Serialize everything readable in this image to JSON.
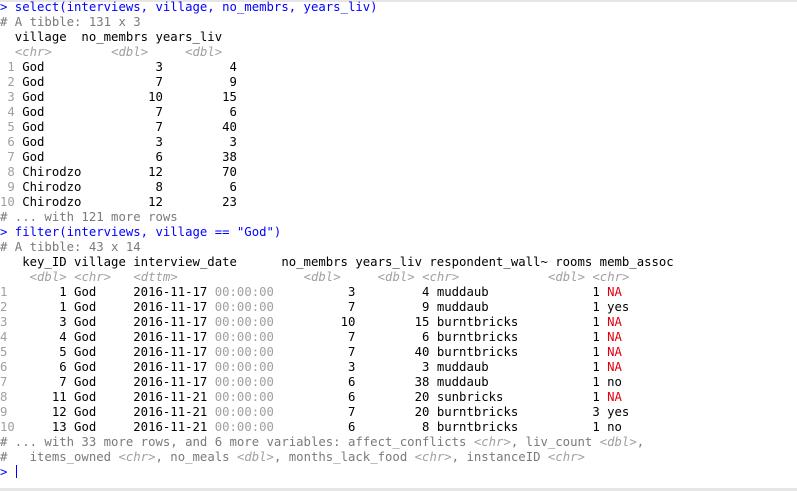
{
  "tibble1": {
    "command": "> select(interviews, village, no_membrs, years_liv)",
    "info": "# A tibble: 131 x 3",
    "header": "  village  no_membrs years_liv",
    "types": [
      {
        "t": "  ",
        "c": ""
      },
      {
        "t": "<chr>",
        "c": "typ"
      },
      {
        "t": "        ",
        "c": ""
      },
      {
        "t": "<dbl>",
        "c": "typ"
      },
      {
        "t": "     ",
        "c": ""
      },
      {
        "t": "<dbl>",
        "c": "typ"
      }
    ],
    "rows": [
      [
        "1",
        "God",
        "3",
        "4"
      ],
      [
        "2",
        "God",
        "7",
        "9"
      ],
      [
        "3",
        "God",
        "10",
        "15"
      ],
      [
        "4",
        "God",
        "7",
        "6"
      ],
      [
        "5",
        "God",
        "7",
        "40"
      ],
      [
        "6",
        "God",
        "3",
        "3"
      ],
      [
        "7",
        "God",
        "6",
        "38"
      ],
      [
        "8",
        "Chirodzo",
        "12",
        "70"
      ],
      [
        "9",
        "Chirodzo",
        "8",
        "6"
      ],
      [
        "10",
        "Chirodzo",
        "12",
        "23"
      ]
    ],
    "more": "# ... with 121 more rows"
  },
  "tibble2": {
    "command": "> filter(interviews, village == \"God\")",
    "info": "# A tibble: 43 x 14",
    "header": "   key_ID village interview_date      no_membrs years_liv respondent_wall~ rooms memb_assoc",
    "types": [
      {
        "t": "    ",
        "c": ""
      },
      {
        "t": "<dbl>",
        "c": "typ"
      },
      {
        "t": " ",
        "c": ""
      },
      {
        "t": "<chr>",
        "c": "typ"
      },
      {
        "t": "   ",
        "c": ""
      },
      {
        "t": "<dttm>",
        "c": "typ"
      },
      {
        "t": "                 ",
        "c": ""
      },
      {
        "t": "<dbl>",
        "c": "typ"
      },
      {
        "t": "     ",
        "c": ""
      },
      {
        "t": "<dbl>",
        "c": "typ"
      },
      {
        "t": " ",
        "c": ""
      },
      {
        "t": "<chr>",
        "c": "typ"
      },
      {
        "t": "            ",
        "c": ""
      },
      {
        "t": "<dbl>",
        "c": "typ"
      },
      {
        "t": " ",
        "c": ""
      },
      {
        "t": "<chr>",
        "c": "typ"
      }
    ],
    "rows": [
      [
        "1",
        "1",
        "God",
        "2016-11-17",
        "00:00:00",
        "3",
        "4",
        "muddaub",
        "1",
        "NA"
      ],
      [
        "2",
        "1",
        "God",
        "2016-11-17",
        "00:00:00",
        "7",
        "9",
        "muddaub",
        "1",
        "yes"
      ],
      [
        "3",
        "3",
        "God",
        "2016-11-17",
        "00:00:00",
        "10",
        "15",
        "burntbricks",
        "1",
        "NA"
      ],
      [
        "4",
        "4",
        "God",
        "2016-11-17",
        "00:00:00",
        "7",
        "6",
        "burntbricks",
        "1",
        "NA"
      ],
      [
        "5",
        "5",
        "God",
        "2016-11-17",
        "00:00:00",
        "7",
        "40",
        "burntbricks",
        "1",
        "NA"
      ],
      [
        "6",
        "6",
        "God",
        "2016-11-17",
        "00:00:00",
        "3",
        "3",
        "muddaub",
        "1",
        "NA"
      ],
      [
        "7",
        "7",
        "God",
        "2016-11-17",
        "00:00:00",
        "6",
        "38",
        "muddaub",
        "1",
        "no"
      ],
      [
        "8",
        "11",
        "God",
        "2016-11-21",
        "00:00:00",
        "6",
        "20",
        "sunbricks",
        "1",
        "NA"
      ],
      [
        "9",
        "12",
        "God",
        "2016-11-21",
        "00:00:00",
        "7",
        "20",
        "burntbricks",
        "3",
        "yes"
      ],
      [
        "10",
        "13",
        "God",
        "2016-11-21",
        "00:00:00",
        "6",
        "8",
        "burntbricks",
        "1",
        "no"
      ]
    ],
    "footer": [
      [
        {
          "t": "# ... with 33 more rows, and 6 more variables: affect_conflicts ",
          "c": "cmt"
        },
        {
          "t": "<chr>",
          "c": "typ"
        },
        {
          "t": ", liv_count ",
          "c": "cmt"
        },
        {
          "t": "<dbl>",
          "c": "typ"
        },
        {
          "t": ",",
          "c": "cmt"
        }
      ],
      [
        {
          "t": "#   items_owned ",
          "c": "cmt"
        },
        {
          "t": "<chr>",
          "c": "typ"
        },
        {
          "t": ", no_meals ",
          "c": "cmt"
        },
        {
          "t": "<dbl>",
          "c": "typ"
        },
        {
          "t": ", months_lack_food ",
          "c": "cmt"
        },
        {
          "t": "<chr>",
          "c": "typ"
        },
        {
          "t": ", instanceID ",
          "c": "cmt"
        },
        {
          "t": "<chr>",
          "c": "typ"
        }
      ]
    ]
  },
  "prompt": ">",
  "colors": {
    "command": "#0000ff",
    "comment": "#7a7a7a",
    "type_hint": "#a0a0a0",
    "na": "#e0000f",
    "text": "#000000"
  }
}
